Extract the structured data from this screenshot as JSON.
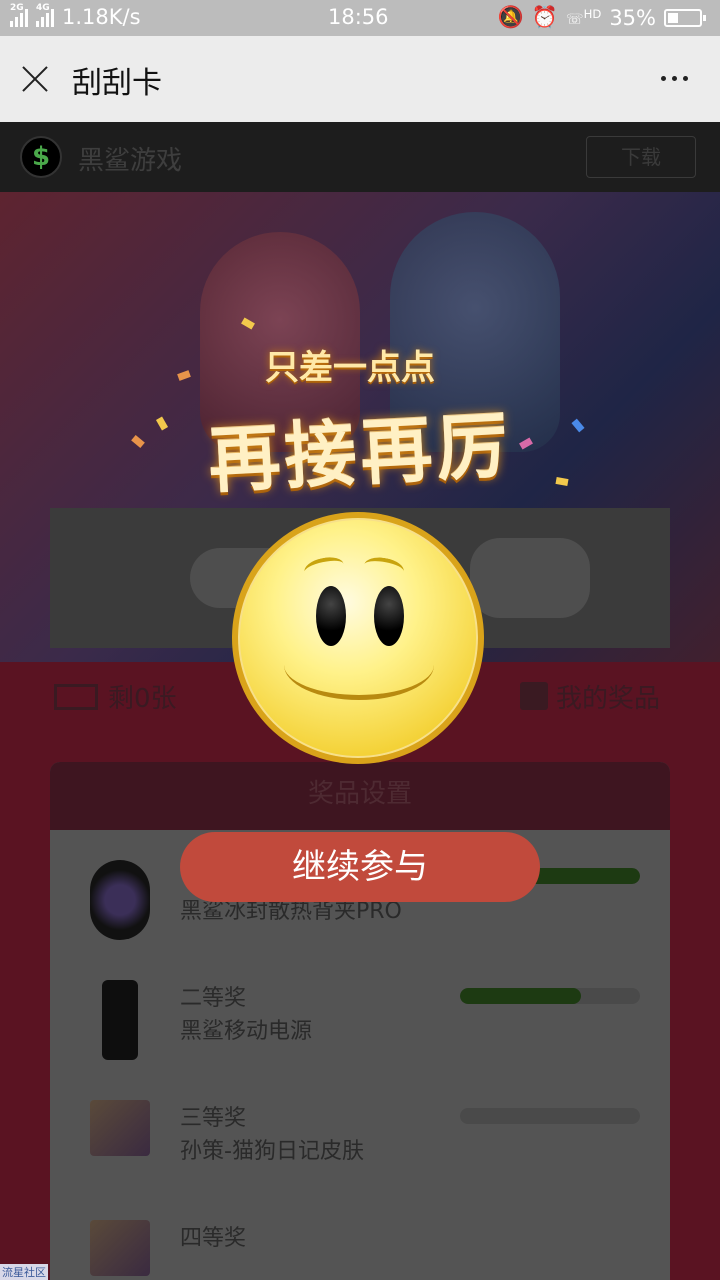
{
  "status_bar": {
    "net1": "2G",
    "net2": "4G",
    "speed": "1.18K/s",
    "time": "18:56",
    "hd": "HD",
    "battery": "35%"
  },
  "header": {
    "title": "刮刮卡"
  },
  "app_bar": {
    "logo": "$",
    "name": "黑鲨游戏",
    "button": "下载"
  },
  "info": {
    "remaining": "剩0张",
    "my_prizes": "我的奖品"
  },
  "prize_panel": {
    "title": "奖品设置",
    "items": [
      {
        "rank": "",
        "name": "黑鲨冰封散热背夹PRO",
        "progress": 1.0
      },
      {
        "rank": "二等奖",
        "name": "黑鲨移动电源",
        "progress": 0.67
      },
      {
        "rank": "三等奖",
        "name": "孙策-猫狗日记皮肤",
        "progress": 0
      },
      {
        "rank": "四等奖",
        "name": "",
        "progress": 0
      }
    ]
  },
  "popup": {
    "subtitle": "只差一点点",
    "title": "再接再厉",
    "button": "继续参与"
  },
  "corner_text": "流星社区",
  "colors": {
    "button_bg": "#c14a3c",
    "smiley": "#f4d238"
  }
}
